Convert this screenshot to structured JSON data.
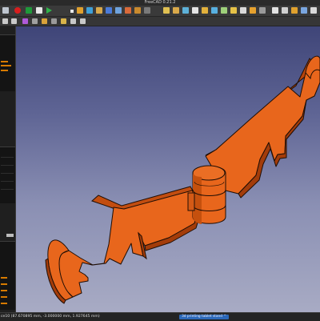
{
  "window": {
    "title": "FreeCAD 0.21.2"
  },
  "statusbar": {
    "coordinates": "ce10 (87.670895 mm, -3.000000 mm, 1.927645 mm)",
    "navigation_style": "3d printing tablet stand ^"
  },
  "colors": {
    "part_face": "#e8661c",
    "part_edge": "#1f0e05",
    "part_dark": "#9e3606",
    "viewport_top": "#3f4578",
    "viewport_bottom": "#a8abc4",
    "sidebar_accent": "#d77a00"
  },
  "icons": {
    "toolbar": [
      "new-document-icon",
      "open-icon",
      "record-macro-icon",
      "stop-macro-icon",
      "edit-macro-icon",
      "run-macro-icon",
      "undo-icon",
      "redo-icon",
      "refresh-icon",
      "measure-icon",
      "view-fit-icon",
      "view-front-icon",
      "view-top-icon",
      "view-right-icon",
      "folder-icon",
      "whats-this-icon"
    ]
  }
}
